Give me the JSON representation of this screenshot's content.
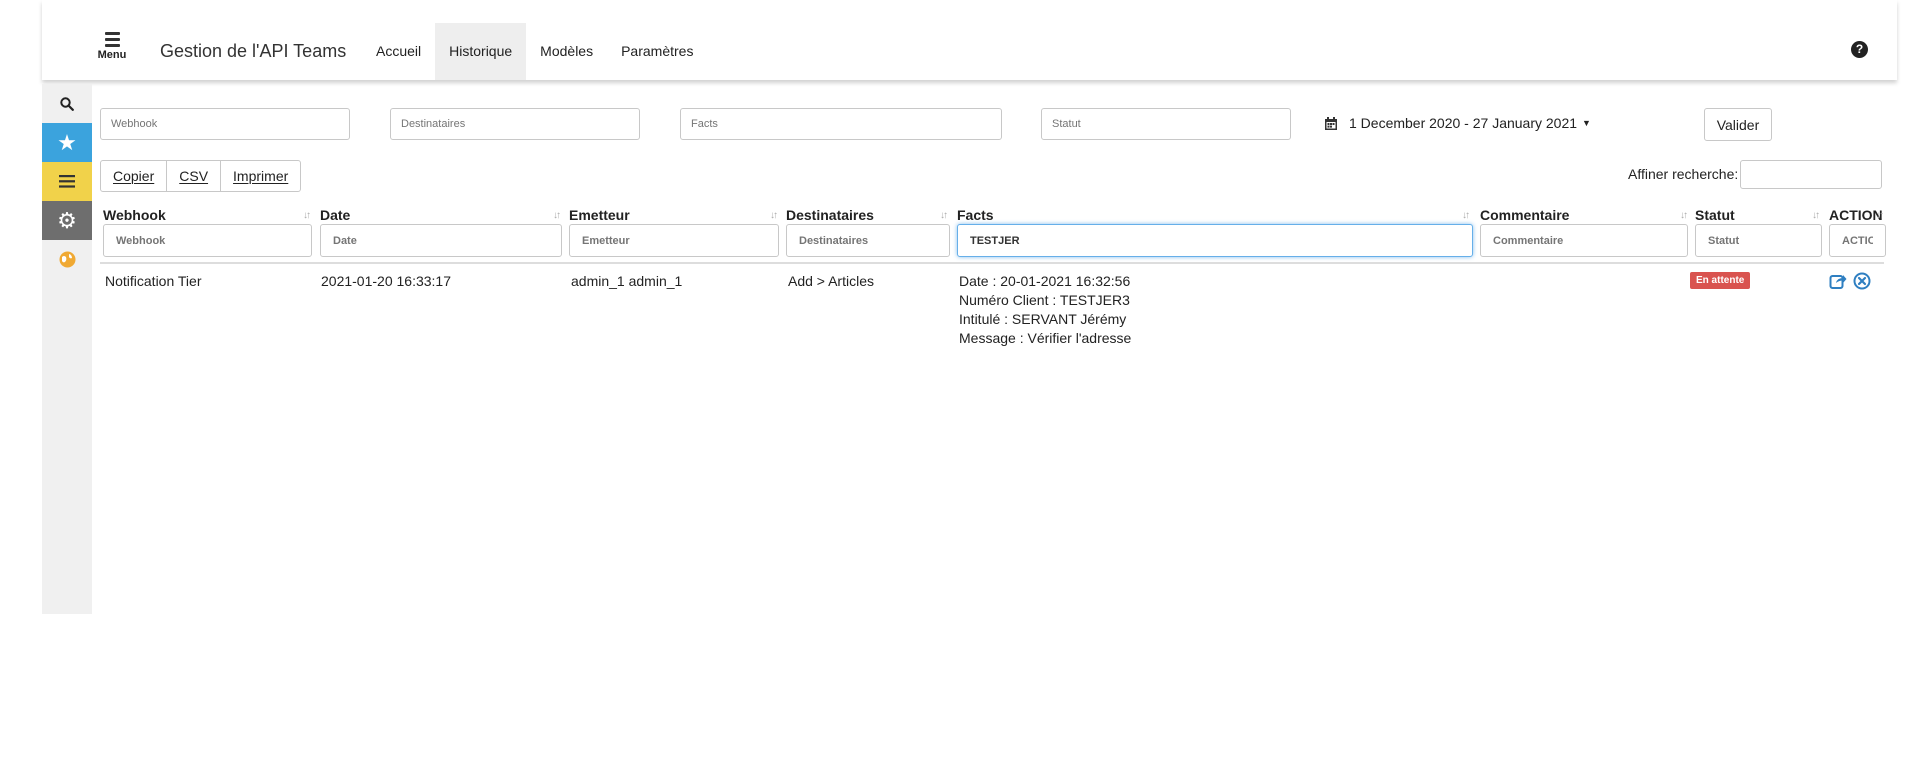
{
  "header": {
    "menu_label": "Menu",
    "app_title": "Gestion de l'API Teams",
    "nav": [
      "Accueil",
      "Historique",
      "Modèles",
      "Paramètres"
    ],
    "active_nav": "Historique",
    "help_glyph": "?"
  },
  "sidebar": {
    "icons": [
      "search-icon",
      "star-icon",
      "list-icon",
      "gear-icon",
      "globe-icon"
    ],
    "colors": {
      "star": "#3ba3dd",
      "list": "#f1d24a",
      "gear": "#6e6e6e"
    }
  },
  "filters": {
    "webhook_placeholder": "Webhook",
    "destinataires_placeholder": "Destinataires",
    "facts_placeholder": "Facts",
    "statut_placeholder": "Statut",
    "date_range": "1 December 2020 - 27 January 2021",
    "valider": "Valider"
  },
  "toolbar": {
    "copier": "Copier",
    "csv": "CSV",
    "imprimer": "Imprimer",
    "search_label": "Affiner recherche:"
  },
  "table": {
    "columns": [
      "Webhook",
      "Date",
      "Emetteur",
      "Destinataires",
      "Facts",
      "Commentaire",
      "Statut",
      "ACTION"
    ],
    "column_filters": {
      "placeholders": [
        "Webhook",
        "Date",
        "Emetteur",
        "Destinataires",
        "Facts",
        "Commentaire",
        "Statut",
        "ACTIO"
      ],
      "facts_value": "TESTJER"
    },
    "rows": [
      {
        "webhook": "Notification Tier",
        "date": "2021-01-20 16:33:17",
        "emetteur": "admin_1 admin_1",
        "destinataires": "Add > Articles",
        "facts": [
          "Date : 20-01-2021 16:32:56",
          "Numéro Client : TESTJER3",
          "Intitulé : SERVANT Jérémy",
          "Message : Vérifier l'adresse"
        ],
        "commentaire": "",
        "statut": "En attente",
        "statut_color": "#d9534f",
        "actions": [
          "share-icon",
          "cancel-icon"
        ]
      }
    ]
  }
}
